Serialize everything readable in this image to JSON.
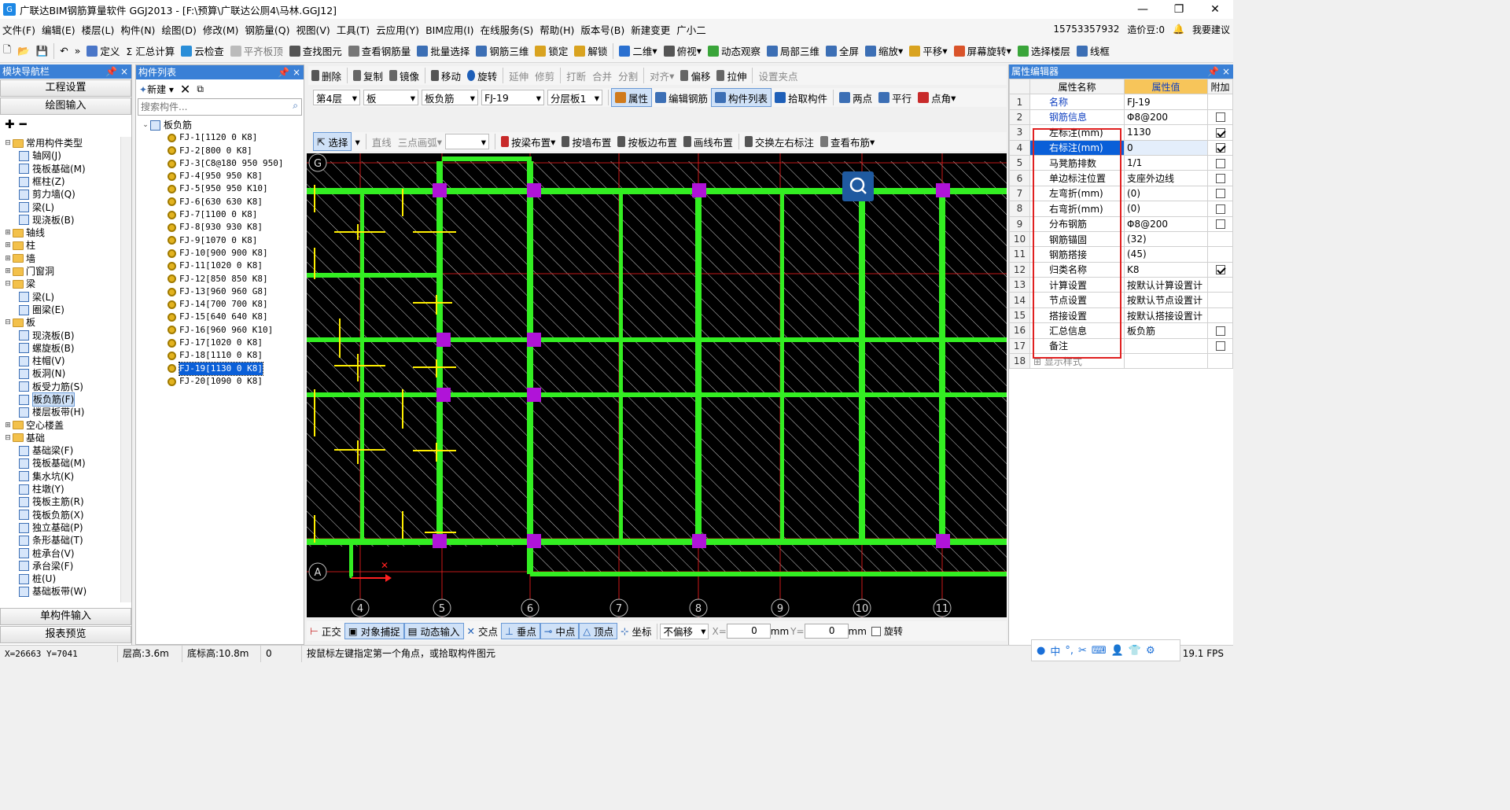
{
  "window": {
    "title": "广联达BIM钢筋算量软件 GGJ2013 - [F:\\预算\\广联达公厕4\\马林.GGJ12]",
    "app_icon": "G",
    "controls": [
      "—",
      "❐",
      "✕"
    ]
  },
  "menu": {
    "items": [
      "文件(F)",
      "编辑(E)",
      "楼层(L)",
      "构件(N)",
      "绘图(D)",
      "修改(M)",
      "钢筋量(Q)",
      "视图(V)",
      "工具(T)",
      "云应用(Y)",
      "BIM应用(I)",
      "在线服务(S)",
      "帮助(H)",
      "版本号(B)",
      "新建变更",
      "广小二"
    ],
    "phone": "15753357932",
    "price_bean": "造价豆:0",
    "suggest": "我要建议"
  },
  "toolbar_main": [
    "定义",
    "Σ 汇总计算",
    "云检查",
    "平齐板顶",
    "查找图元",
    "查看钢筋量",
    "批量选择",
    "钢筋三维",
    "锁定",
    "解锁",
    "二维",
    "俯视",
    "动态观察",
    "局部三维",
    "全屏",
    "缩放",
    "平移",
    "屏幕旋转",
    "选择楼层",
    "线框"
  ],
  "edit_toolbar": [
    "删除",
    "复制",
    "镜像",
    "移动",
    "旋转",
    "延伸",
    "修剪",
    "打断",
    "合并",
    "分割",
    "对齐",
    "偏移",
    "拉伸",
    "设置夹点"
  ],
  "layer_toolbar": {
    "floor": "第4层",
    "type": "板",
    "category": "板负筋",
    "component": "FJ-19",
    "sublayer": "分层板1",
    "buttons": [
      "属性",
      "编辑钢筋",
      "构件列表",
      "拾取构件",
      "两点",
      "平行",
      "点角"
    ]
  },
  "draw_toolbar": [
    "选择",
    "直线",
    "三点画弧",
    "按梁布置",
    "按墙布置",
    "按板边布置",
    "画线布置",
    "交换左右标注",
    "查看布筋"
  ],
  "nav": {
    "header": "模块导航栏",
    "buttons": [
      "工程设置",
      "绘图输入"
    ],
    "bottom_buttons": [
      "单构件输入",
      "报表预览"
    ],
    "tree": [
      {
        "level": 0,
        "toggle": "⊟",
        "folder": true,
        "label": "常用构件类型"
      },
      {
        "level": 1,
        "label": "轴网(J)"
      },
      {
        "level": 1,
        "label": "筏板基础(M)"
      },
      {
        "level": 1,
        "label": "框柱(Z)"
      },
      {
        "level": 1,
        "label": "剪力墙(Q)"
      },
      {
        "level": 1,
        "label": "梁(L)"
      },
      {
        "level": 1,
        "label": "现浇板(B)"
      },
      {
        "level": 0,
        "toggle": "⊞",
        "folder": true,
        "label": "轴线"
      },
      {
        "level": 0,
        "toggle": "⊞",
        "folder": true,
        "label": "柱"
      },
      {
        "level": 0,
        "toggle": "⊞",
        "folder": true,
        "label": "墙"
      },
      {
        "level": 0,
        "toggle": "⊞",
        "folder": true,
        "label": "门窗洞"
      },
      {
        "level": 0,
        "toggle": "⊟",
        "folder": true,
        "label": "梁"
      },
      {
        "level": 1,
        "label": "梁(L)"
      },
      {
        "level": 1,
        "label": "圈梁(E)"
      },
      {
        "level": 0,
        "toggle": "⊟",
        "folder": true,
        "label": "板"
      },
      {
        "level": 1,
        "label": "现浇板(B)"
      },
      {
        "level": 1,
        "label": "螺旋板(B)"
      },
      {
        "level": 1,
        "label": "柱帽(V)"
      },
      {
        "level": 1,
        "label": "板洞(N)"
      },
      {
        "level": 1,
        "label": "板受力筋(S)"
      },
      {
        "level": 1,
        "label": "板负筋(F)",
        "selected": true
      },
      {
        "level": 1,
        "label": "楼层板带(H)"
      },
      {
        "level": 0,
        "toggle": "⊞",
        "folder": true,
        "label": "空心楼盖"
      },
      {
        "level": 0,
        "toggle": "⊟",
        "folder": true,
        "label": "基础"
      },
      {
        "level": 1,
        "label": "基础梁(F)"
      },
      {
        "level": 1,
        "label": "筏板基础(M)"
      },
      {
        "level": 1,
        "label": "集水坑(K)"
      },
      {
        "level": 1,
        "label": "柱墩(Y)"
      },
      {
        "level": 1,
        "label": "筏板主筋(R)"
      },
      {
        "level": 1,
        "label": "筏板负筋(X)"
      },
      {
        "level": 1,
        "label": "独立基础(P)"
      },
      {
        "level": 1,
        "label": "条形基础(T)"
      },
      {
        "level": 1,
        "label": "桩承台(V)"
      },
      {
        "level": 1,
        "label": "承台梁(F)"
      },
      {
        "level": 1,
        "label": "桩(U)"
      },
      {
        "level": 1,
        "label": "基础板带(W)"
      }
    ]
  },
  "component_list": {
    "header": "构件列表",
    "new_button": "新建",
    "search_placeholder": "搜索构件...",
    "root": "板负筋",
    "items": [
      "FJ-1[1120 0 K8]",
      "FJ-2[800 0 K8]",
      "FJ-3[C8@180 950 950]",
      "FJ-4[950 950 K8]",
      "FJ-5[950 950 K10]",
      "FJ-6[630 630 K8]",
      "FJ-7[1100 0 K8]",
      "FJ-8[930 930 K8]",
      "FJ-9[1070 0 K8]",
      "FJ-10[900 900 K8]",
      "FJ-11[1020 0 K8]",
      "FJ-12[850 850 K8]",
      "FJ-13[960 960 G8]",
      "FJ-14[700 700 K8]",
      "FJ-15[640 640 K8]",
      "FJ-16[960 960 K10]",
      "FJ-17[1020 0 K8]",
      "FJ-18[1110 0 K8]",
      "FJ-19[1130 0 K8]",
      "FJ-20[1090 0 K8]"
    ],
    "selected_index": 18
  },
  "properties": {
    "header": "属性编辑器",
    "columns": [
      "属性名称",
      "属性值",
      "附加"
    ],
    "rows": [
      {
        "n": "1",
        "name": "名称",
        "value": "FJ-19",
        "check": null,
        "blue": true
      },
      {
        "n": "2",
        "name": "钢筋信息",
        "value": "Φ8@200",
        "check": false,
        "blue": true
      },
      {
        "n": "3",
        "name": "左标注(mm)",
        "value": "1130",
        "check": true
      },
      {
        "n": "4",
        "name": "右标注(mm)",
        "value": "0",
        "check": true,
        "selected": true
      },
      {
        "n": "5",
        "name": "马凳筋排数",
        "value": "1/1",
        "check": false
      },
      {
        "n": "6",
        "name": "单边标注位置",
        "value": "支座外边线",
        "check": false
      },
      {
        "n": "7",
        "name": "左弯折(mm)",
        "value": "(0)",
        "check": false
      },
      {
        "n": "8",
        "name": "右弯折(mm)",
        "value": "(0)",
        "check": false
      },
      {
        "n": "9",
        "name": "分布钢筋",
        "value": "Φ8@200",
        "check": false
      },
      {
        "n": "10",
        "name": "钢筋锚固",
        "value": "(32)",
        "check": null
      },
      {
        "n": "11",
        "name": "钢筋搭接",
        "value": "(45)",
        "check": null
      },
      {
        "n": "12",
        "name": "归类名称",
        "value": "K8",
        "check": true
      },
      {
        "n": "13",
        "name": "计算设置",
        "value": "按默认计算设置计",
        "check": null
      },
      {
        "n": "14",
        "name": "节点设置",
        "value": "按默认节点设置计",
        "check": null
      },
      {
        "n": "15",
        "name": "搭接设置",
        "value": "按默认搭接设置计",
        "check": null
      },
      {
        "n": "16",
        "name": "汇总信息",
        "value": "板负筋",
        "check": false
      },
      {
        "n": "17",
        "name": "备注",
        "value": "",
        "check": false
      },
      {
        "n": "18",
        "name": "显示样式",
        "value": "",
        "check": null,
        "gray": true
      }
    ]
  },
  "canvas": {
    "axis_bottom": [
      "4",
      "5",
      "6",
      "7",
      "8",
      "9",
      "10",
      "11"
    ],
    "axis_left": [
      "G",
      "A"
    ],
    "colors": {
      "beam": "#33ee22",
      "column": "#b013d8",
      "rebar": "#ffee00",
      "grid": "#ff2020",
      "bg": "#000000"
    }
  },
  "snap_toolbar": {
    "items": [
      "正交",
      "对象捕捉",
      "动态输入",
      "交点",
      "垂点",
      "中点",
      "顶点",
      "坐标"
    ],
    "offset_mode": "不偏移",
    "x_label": "X=",
    "x_value": "0",
    "y_label": "Y=",
    "y_value": "0",
    "unit": "mm",
    "rotate": "旋转"
  },
  "status": {
    "coords": "X=26663 Y=7041",
    "floor_height": "层高:3.6m",
    "base_elev": "底标高:10.8m",
    "zero": "0",
    "hint": "按鼠标左键指定第一个角点，或拾取构件图元",
    "fps": "19.1 FPS",
    "tray_lang": "中"
  }
}
